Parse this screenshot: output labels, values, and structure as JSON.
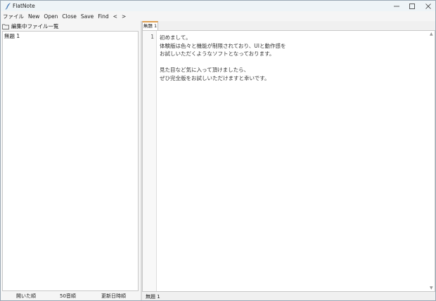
{
  "window": {
    "title": "FlatNote",
    "icon": "quill-icon"
  },
  "menu": {
    "items": [
      "ファイル",
      "New",
      "Open",
      "Close",
      "Save",
      "Find",
      "<",
      ">"
    ]
  },
  "left_pane": {
    "header_label": "編集中ファイル一覧",
    "files": [
      "無題 1"
    ],
    "sort_buttons": [
      "開いた順",
      "50音順",
      "更新日時順"
    ]
  },
  "editor": {
    "tab_label": "無題 1",
    "line_numbers": [
      "1"
    ],
    "lines": [
      "初めまして。",
      "体験版は色々と機能が制限されており、UIと動作感を",
      "お試しいただくようなソフトとなっております。",
      "",
      "見た目など気に入って頂けましたら、",
      "ぜひ完全版をお試しいただけますと幸いです。"
    ],
    "status_text": "無題 1"
  },
  "colors": {
    "tab_accent": "#e0a050",
    "titlebar_bg": "#eef4f7"
  }
}
